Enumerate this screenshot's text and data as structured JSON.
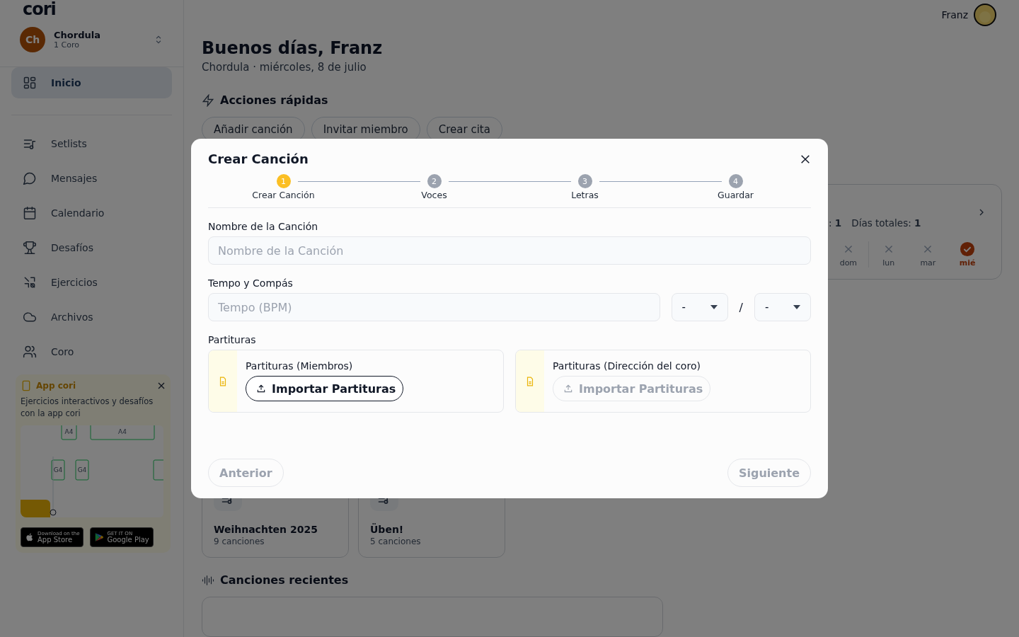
{
  "sidebar": {
    "logo": "cori",
    "org": {
      "initials": "Ch",
      "name": "Chordula",
      "subtitle": "1 Coro"
    },
    "nav": [
      {
        "label": "Inicio",
        "selected": true
      },
      {
        "label": "Setlists",
        "selected": false
      },
      {
        "label": "Mensajes",
        "selected": false
      },
      {
        "label": "Calendario",
        "selected": false
      },
      {
        "label": "Desafíos",
        "selected": false
      },
      {
        "label": "Ejercicios",
        "selected": false
      },
      {
        "label": "Archivos",
        "selected": false
      },
      {
        "label": "Coro",
        "selected": false
      }
    ],
    "promo": {
      "title": "App cori",
      "text": "Ejercicios interactivos y desafíos con la app cori",
      "notes": [
        "A4",
        "A4",
        "G4",
        "G4"
      ],
      "badges": [
        {
          "small": "Download on the",
          "big": "App Store"
        },
        {
          "small": "GET IT ON",
          "big": "Google Play"
        }
      ]
    }
  },
  "header": {
    "user": "Franz"
  },
  "greeting": {
    "title": "Buenos días, Franz",
    "subtitle": "Chordula · miércoles, 8 de julio"
  },
  "quick_actions": {
    "title": "Acciones rápidas",
    "buttons": [
      "Añadir canción",
      "Invitar miembro",
      "Crear cita"
    ]
  },
  "streak": {
    "stats": [
      {
        "label": ":",
        "value": "1"
      },
      {
        "label": "Días totales:",
        "value": "1"
      }
    ],
    "days": [
      {
        "label": "dom",
        "done": false
      },
      {
        "label": "lun",
        "done": false
      },
      {
        "label": "mar",
        "done": false
      },
      {
        "label": "mié",
        "done": true
      }
    ]
  },
  "setlists": [
    {
      "name": "Weihnachten 2025",
      "count": "9 canciones"
    },
    {
      "name": "Üben!",
      "count": "5 canciones"
    }
  ],
  "recent": {
    "title": "Canciones recientes"
  },
  "modal": {
    "title": "Crear Canción",
    "steps": [
      {
        "number": "1",
        "label": "Crear Canción",
        "selected": true
      },
      {
        "number": "2",
        "label": "Voces",
        "selected": false
      },
      {
        "number": "3",
        "label": "Letras",
        "selected": false
      },
      {
        "number": "4",
        "label": "Guardar",
        "selected": false
      }
    ],
    "name_field": {
      "label": "Nombre de la Canción",
      "placeholder": "Nombre de la Canción"
    },
    "tempo": {
      "label": "Tempo y Compás",
      "placeholder": "Tempo (BPM)",
      "numerator": "-",
      "separator": "/",
      "denominator": "-"
    },
    "scores": {
      "label": "Partituras",
      "cards": [
        {
          "title": "Partituras (Miembros)",
          "button": "Importar Partituras",
          "disabled": false
        },
        {
          "title": "Partituras (Dirección del coro)",
          "button": "Importar Partituras",
          "disabled": true
        }
      ]
    },
    "footer": [
      {
        "label": "Anterior",
        "disabled": true
      },
      {
        "label": "Siguiente",
        "disabled": true
      }
    ]
  }
}
